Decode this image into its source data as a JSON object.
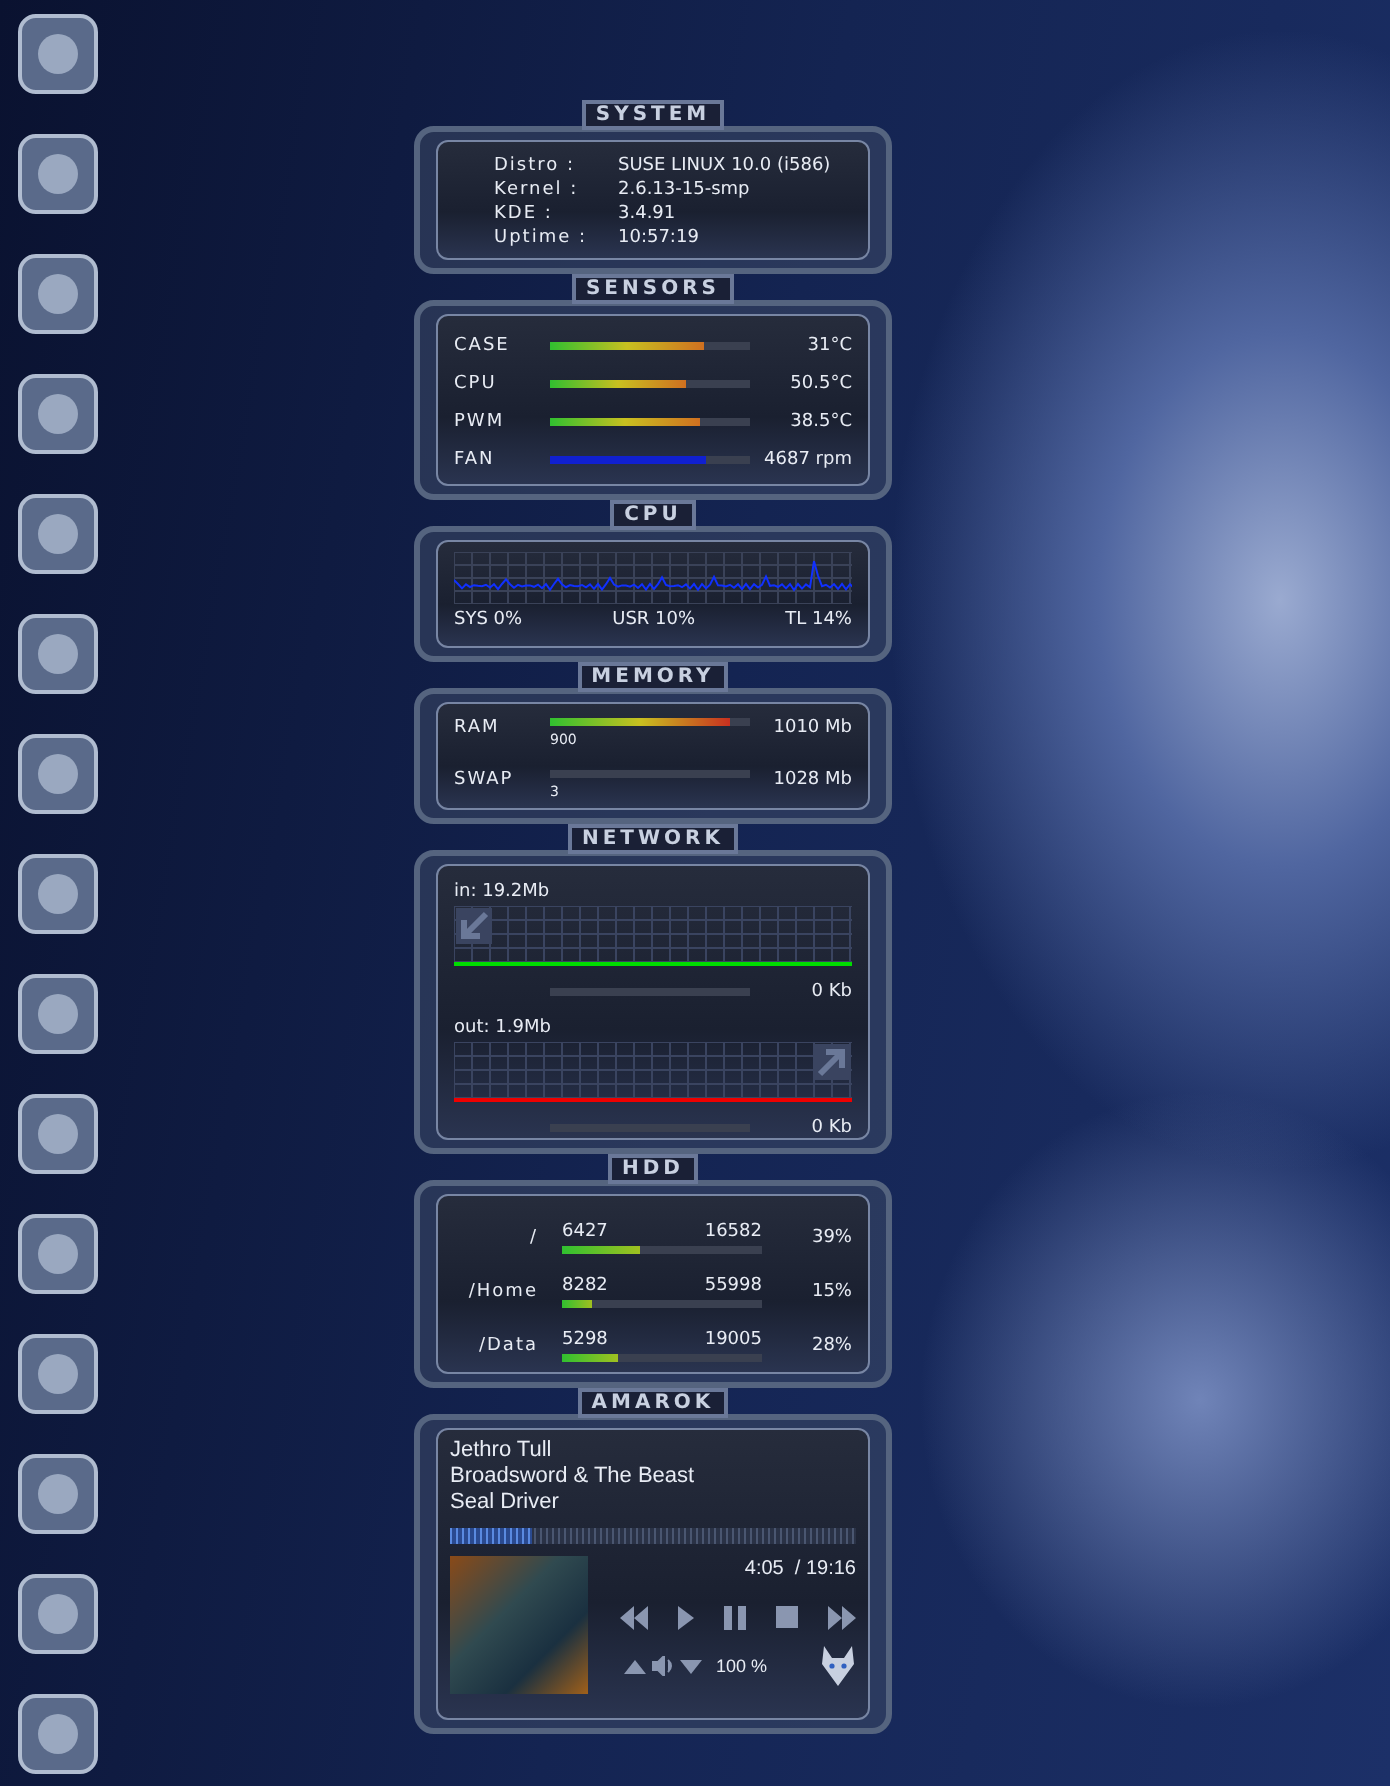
{
  "system": {
    "title": "SYSTEM",
    "rows": [
      {
        "label": "Distro :",
        "value": "SUSE LINUX 10.0 (i586)"
      },
      {
        "label": "Kernel :",
        "value": "2.6.13-15-smp"
      },
      {
        "label": "KDE :",
        "value": "3.4.91"
      },
      {
        "label": "Uptime :",
        "value": "10:57:19"
      }
    ]
  },
  "sensors": {
    "title": "SENSORS",
    "rows": [
      {
        "label": "CASE",
        "kind": "temperature",
        "level": 0.77,
        "reading": "31°C"
      },
      {
        "label": "CPU",
        "kind": "temperature",
        "level": 0.68,
        "reading": "50.5°C"
      },
      {
        "label": "PWM",
        "kind": "temperature",
        "level": 0.75,
        "reading": "38.5°C"
      },
      {
        "label": "FAN",
        "kind": "fan",
        "level": 0.78,
        "reading": "4687 rpm"
      }
    ]
  },
  "cpu": {
    "title": "CPU",
    "sys": "SYS 0%",
    "usr": "USR 10%",
    "total": "TL 14%"
  },
  "memory": {
    "title": "MEMORY",
    "rows": [
      {
        "label": "RAM",
        "level": 0.9,
        "used": "900",
        "total": "1010 Mb"
      },
      {
        "label": "SWAP",
        "used": "3",
        "total": "1028 Mb"
      }
    ]
  },
  "network": {
    "title": "NETWORK",
    "rows": [
      {
        "label": "in: 19.2Mb",
        "kind": "in",
        "color": "#00dd00",
        "reading": "0 Kb"
      },
      {
        "label": "out: 1.9Mb",
        "kind": "out",
        "color": "#ee0000",
        "reading": "0 Kb"
      }
    ]
  },
  "hdd": {
    "title": "HDD",
    "rows": [
      {
        "mount": "/",
        "used": "6427",
        "total": "16582",
        "level": 0.39,
        "percent": "39%"
      },
      {
        "mount": "/Home",
        "used": "8282",
        "total": "55998",
        "level": 0.15,
        "percent": "15%"
      },
      {
        "mount": "/Data",
        "used": "5298",
        "total": "19005",
        "level": 0.28,
        "percent": "28%"
      }
    ]
  },
  "amarok": {
    "title": "AMAROK",
    "artist": "Jethro Tull",
    "album": "Broadsword & The Beast",
    "track": "Seal Driver",
    "level": 0.2,
    "time": "4:05  / 19:16",
    "volume": "100 %"
  }
}
